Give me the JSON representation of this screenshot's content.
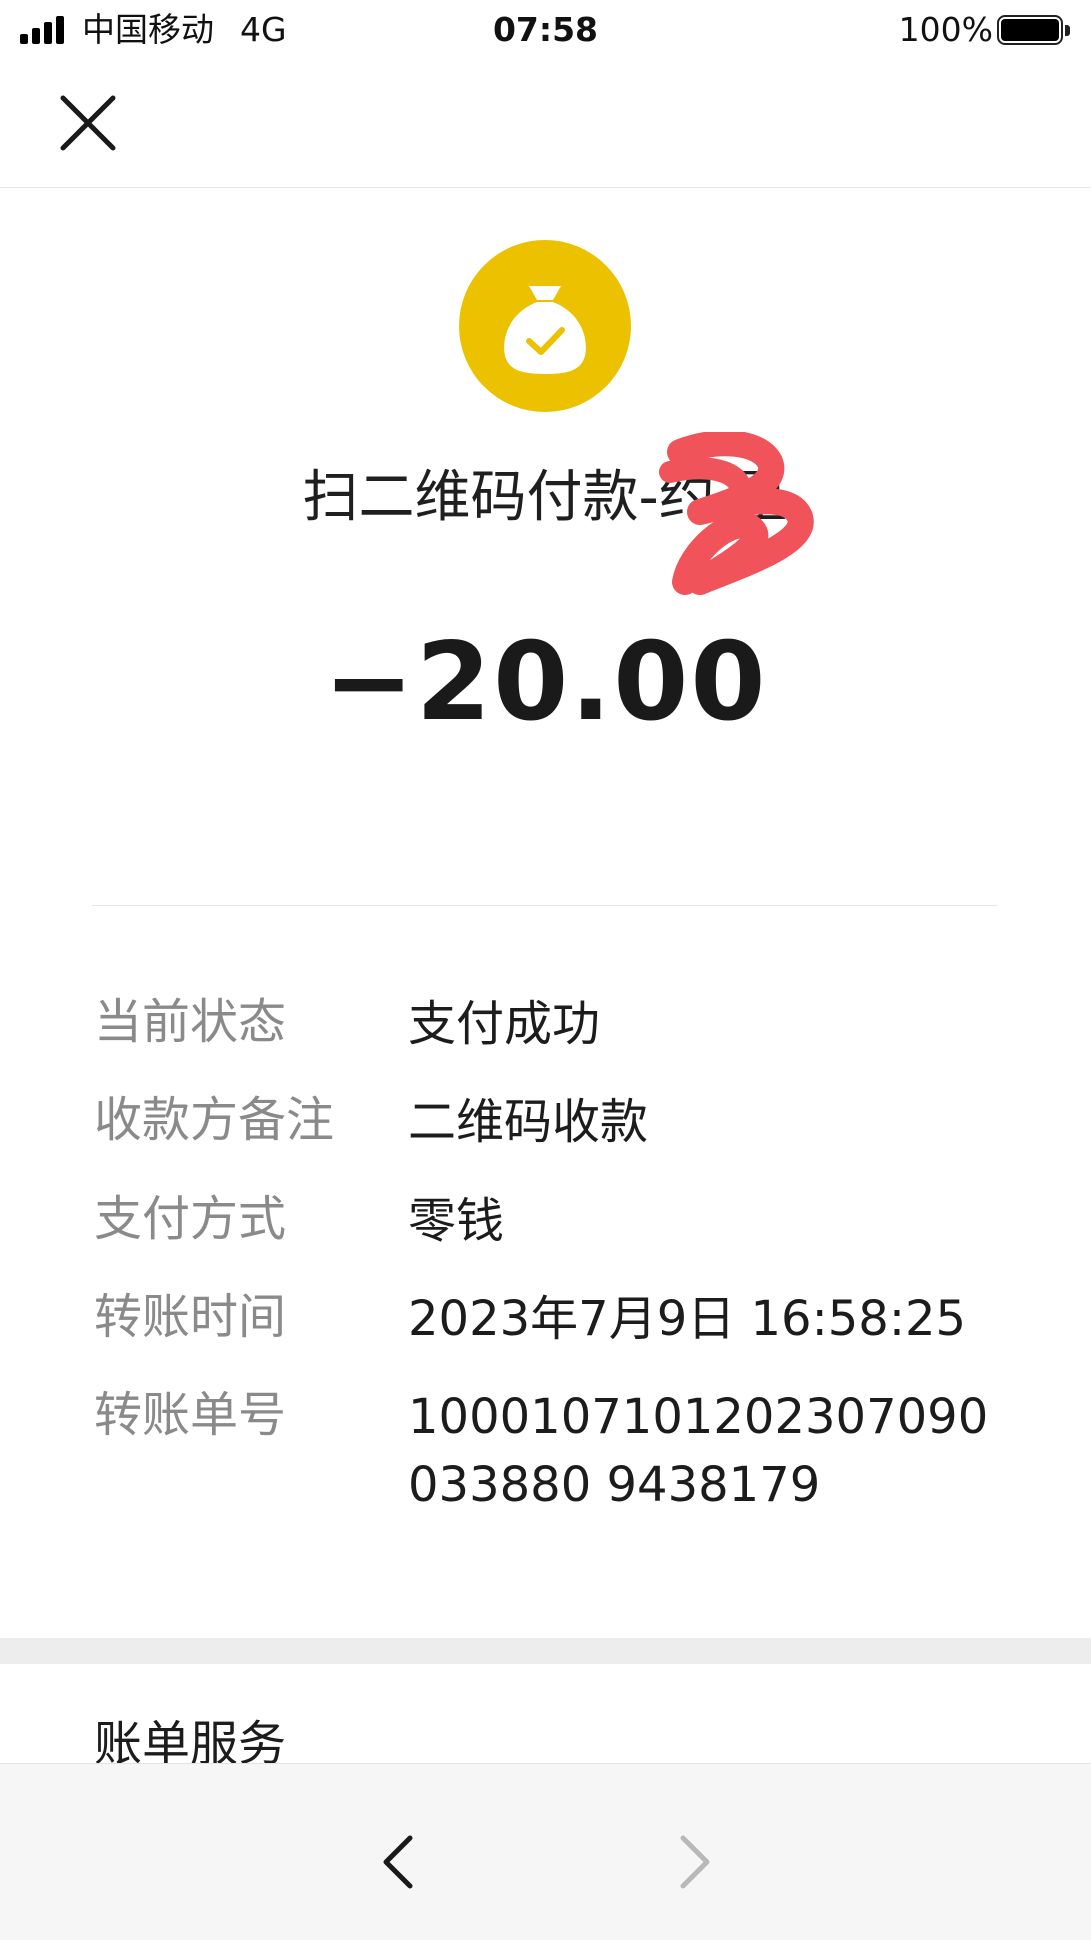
{
  "status_bar": {
    "carrier": "中国移动",
    "network": "4G",
    "time": "07:58",
    "battery_percent": "100%",
    "battery_level": 1.0
  },
  "header": {
    "icon": "money-bag-check-icon",
    "icon_color": "#ECC100",
    "merchant": "扫二维码付款-约    星",
    "amount": "−20.00"
  },
  "details": [
    {
      "label": "当前状态",
      "value": "支付成功"
    },
    {
      "label": "收款方备注",
      "value": "二维码收款"
    },
    {
      "label": "支付方式",
      "value": "零钱"
    },
    {
      "label": "转账时间",
      "value": "2023年7月9日 16:58:25"
    },
    {
      "label": "转账单号",
      "value": "1000107101202307090033880 9438179"
    }
  ],
  "bill_service": {
    "title": "账单服务"
  },
  "bottom_nav": {
    "back_icon": "chevron-left-icon",
    "forward_icon": "chevron-right-icon"
  }
}
